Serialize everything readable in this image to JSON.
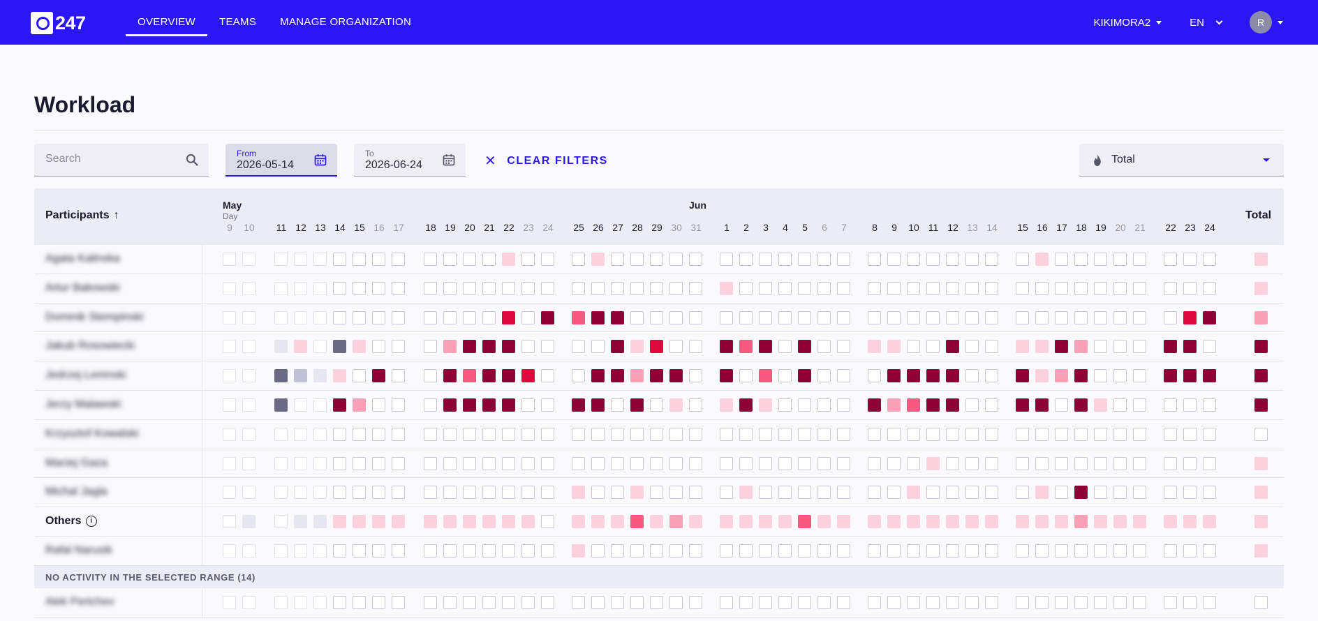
{
  "nav": {
    "logo_text": "247",
    "items": [
      {
        "label": "OVERVIEW",
        "active": true
      },
      {
        "label": "TEAMS",
        "active": false
      },
      {
        "label": "MANAGE ORGANIZATION",
        "active": false
      }
    ],
    "org": "KIKIMORA2",
    "lang": "EN",
    "avatar": "R"
  },
  "page": {
    "title": "Workload"
  },
  "filters": {
    "search_placeholder": "Search",
    "from_label": "From",
    "from_value": "2026-05-14",
    "to_label": "To",
    "to_value": "2026-06-24",
    "clear_label": "CLEAR FILTERS",
    "metric_value": "Total"
  },
  "table": {
    "participants_header": "Participants",
    "sort_arrow": "↑",
    "total_header": "Total",
    "day_label": "Day",
    "months": [
      {
        "label": "May",
        "start_index": 0
      },
      {
        "label": "Jun",
        "start_index": 22
      }
    ],
    "days": [
      {
        "d": "9",
        "w": true
      },
      {
        "d": "10",
        "w": true
      },
      {
        "d": "11",
        "w": false
      },
      {
        "d": "12",
        "w": false
      },
      {
        "d": "13",
        "w": false
      },
      {
        "d": "14",
        "w": false
      },
      {
        "d": "15",
        "w": false
      },
      {
        "d": "16",
        "w": true
      },
      {
        "d": "17",
        "w": true
      },
      {
        "d": "18",
        "w": false
      },
      {
        "d": "19",
        "w": false
      },
      {
        "d": "20",
        "w": false
      },
      {
        "d": "21",
        "w": false
      },
      {
        "d": "22",
        "w": false
      },
      {
        "d": "23",
        "w": true
      },
      {
        "d": "24",
        "w": true
      },
      {
        "d": "25",
        "w": false
      },
      {
        "d": "26",
        "w": false
      },
      {
        "d": "27",
        "w": false
      },
      {
        "d": "28",
        "w": false
      },
      {
        "d": "29",
        "w": false
      },
      {
        "d": "30",
        "w": true
      },
      {
        "d": "31",
        "w": true
      },
      {
        "d": "1",
        "w": false
      },
      {
        "d": "2",
        "w": false
      },
      {
        "d": "3",
        "w": false
      },
      {
        "d": "4",
        "w": false
      },
      {
        "d": "5",
        "w": false
      },
      {
        "d": "6",
        "w": true
      },
      {
        "d": "7",
        "w": true
      },
      {
        "d": "8",
        "w": false
      },
      {
        "d": "9",
        "w": false
      },
      {
        "d": "10",
        "w": false
      },
      {
        "d": "11",
        "w": false
      },
      {
        "d": "12",
        "w": false
      },
      {
        "d": "13",
        "w": true
      },
      {
        "d": "14",
        "w": true
      },
      {
        "d": "15",
        "w": false
      },
      {
        "d": "16",
        "w": false
      },
      {
        "d": "17",
        "w": false
      },
      {
        "d": "18",
        "w": false
      },
      {
        "d": "19",
        "w": false
      },
      {
        "d": "20",
        "w": true
      },
      {
        "d": "21",
        "w": true
      },
      {
        "d": "22",
        "w": false
      },
      {
        "d": "23",
        "w": false
      },
      {
        "d": "24",
        "w": false
      }
    ],
    "past_count": 5,
    "legend_colors": {
      "0": "#ffffff",
      "1": "#fcd0dc",
      "2": "#fca0b8",
      "3": "#f65880",
      "4": "#e0083a",
      "5": "#8e0033",
      "g1": "#e6e6f0",
      "g2": "#c2c2d6",
      "g3": "#6a6a85"
    },
    "rows": [
      {
        "name": "Agata Kalinska",
        "other": false,
        "cells": "00000 0000 0000100 0100000 0000000 0000000 0100000 000",
        "total": "1"
      },
      {
        "name": "Artur Bakowski",
        "other": false,
        "cells": "00000 0000 0000000 0000000 1000000 0000000 0000000 000",
        "total": "1"
      },
      {
        "name": "Dominik Stempinski",
        "other": false,
        "cells": "00000 0000 0000405 3550000 0000000 0000000 0000000 045",
        "total": "2"
      },
      {
        "name": "Jakub Rosowiecki",
        "other": false,
        "cells": "00g10a 100 0255500 0051400 5350500 1100500 1152000 550",
        "total": "5"
      },
      {
        "name": "Jedrzej Lemnski",
        "other": false,
        "cells": "00b2c1 050 0535540 0552550 5030500 0555500 5125000 555",
        "total": "5"
      },
      {
        "name": "Jerzy Malawski",
        "other": false,
        "cells": "00b00 5200 0555500 5505010 1510000 5235500 5505100 000",
        "total": "5"
      },
      {
        "name": "Krzysztof Kowalski",
        "other": false,
        "cells": "00000 0000 0000000 0000000 0000000 0000000 0000000 000",
        "total": "0"
      },
      {
        "name": "Maciej Gaza",
        "other": false,
        "cells": "00000 0000 0000000 0000000 0000000 0001000 0000000 000",
        "total": "1"
      },
      {
        "name": "Michal Jagla",
        "other": false,
        "cells": "00000 0000 0000000 1001000 0100000 0010000 0105000 000",
        "total": "1"
      },
      {
        "name": "Others",
        "other": true,
        "cells": "0d0dd 1111 1111110 1113121 1111311 1111111 1112111 111",
        "total": "1"
      },
      {
        "name": "Rafal Narusik",
        "other": false,
        "cells": "00000 0000 0000000 1000000 0000000 0000000 0000000 000",
        "total": "1"
      }
    ],
    "section_label": "NO ACTIVITY IN THE SELECTED RANGE (14)",
    "inactive_rows": [
      {
        "name": "Alek Pertchev"
      }
    ]
  }
}
